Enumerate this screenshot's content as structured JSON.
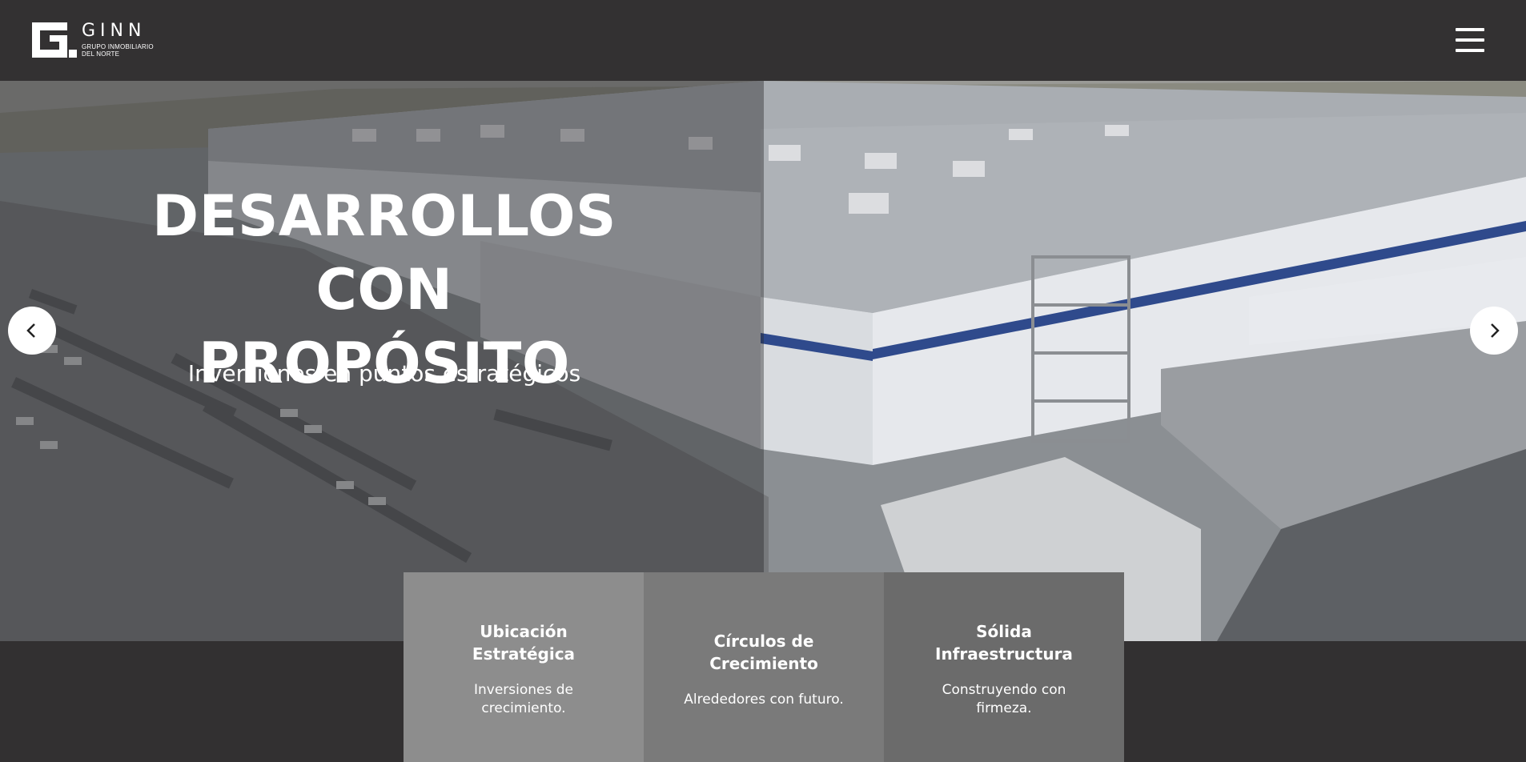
{
  "header": {
    "logo_name": "GINN",
    "logo_line1": "GRUPO INMOBILIARIO",
    "logo_line2": "DEL NORTE",
    "menu_icon": "hamburger-icon"
  },
  "hero": {
    "title_line1": "DESARROLLOS CON",
    "title_line2": "PROPÓSITO",
    "subtitle": "Inversiones en puntos estratégicos",
    "prev_icon": "chevron-left-icon",
    "next_icon": "chevron-right-icon"
  },
  "features": [
    {
      "title": "Ubicación Estratégica",
      "text": "Inversiones de crecimiento."
    },
    {
      "title": "Círculos de Crecimiento",
      "text": "Alrededores con futuro."
    },
    {
      "title": "Sólida Infraestructura",
      "text": "Construyendo con firmeza."
    }
  ],
  "colors": {
    "header_bg": "#333132",
    "card_1": "#8d8d8d",
    "card_2": "#7a7a7a",
    "card_3": "#6b6b6b",
    "building_stripe": "#2f4a8c"
  }
}
